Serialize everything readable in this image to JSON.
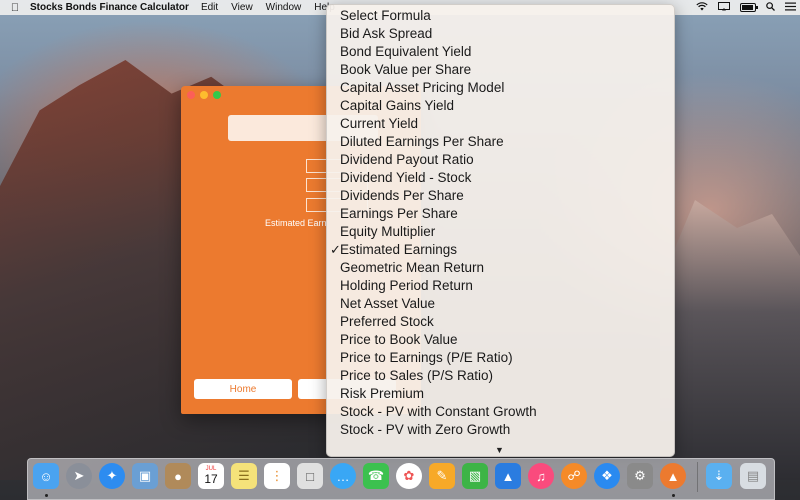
{
  "menubar": {
    "app_name": "Stocks Bonds Finance Calculator",
    "items": [
      "Edit",
      "View",
      "Window",
      "Help"
    ]
  },
  "window": {
    "estimated_label": "Estimated Earn",
    "home_label": "Home"
  },
  "dropdown": {
    "selected": "Estimated Earnings",
    "options": [
      "Select Formula",
      "Bid Ask Spread",
      "Bond Equivalent Yield",
      "Book Value per Share",
      "Capital Asset Pricing Model",
      "Capital Gains Yield",
      "Current Yield",
      "Diluted Earnings Per Share",
      "Dividend Payout Ratio",
      "Dividend Yield - Stock",
      "Dividends Per Share",
      "Earnings Per Share",
      "Equity Multiplier",
      "Estimated Earnings",
      "Geometric Mean Return",
      "Holding Period Return",
      "Net Asset Value",
      "Preferred Stock",
      "Price to Book Value",
      "Price to Earnings (P/E Ratio)",
      "Price to Sales (P/S Ratio)",
      "Risk Premium",
      "Stock - PV with Constant Growth",
      "Stock - PV with Zero Growth"
    ]
  },
  "dock": {
    "calendar_month": "JUL",
    "calendar_day": "17",
    "colors": {
      "finder": "#4aa3f0",
      "launchpad": "#8a8f99",
      "safari": "#2d8cf0",
      "preview": "#6a9fd4",
      "contacts": "#b08a5a",
      "calendar": "#ffffff",
      "notes": "#f5e27a",
      "reminders": "#ffffff",
      "photobooth": "#e0e0e0",
      "messages": "#39a7f5",
      "facetime": "#3cc14f",
      "photos": "#ffffff",
      "pages": "#f7a928",
      "numbers": "#3db446",
      "keynote": "#2a7ce0",
      "itunes": "#fa4b7d",
      "ibooks": "#f58a28",
      "appstore": "#2a8af0",
      "sysprefs": "#8a8a8a",
      "calculator": "#ec7a2f",
      "downloads": "#5ab0f0",
      "trash": "#d8dde2"
    }
  }
}
